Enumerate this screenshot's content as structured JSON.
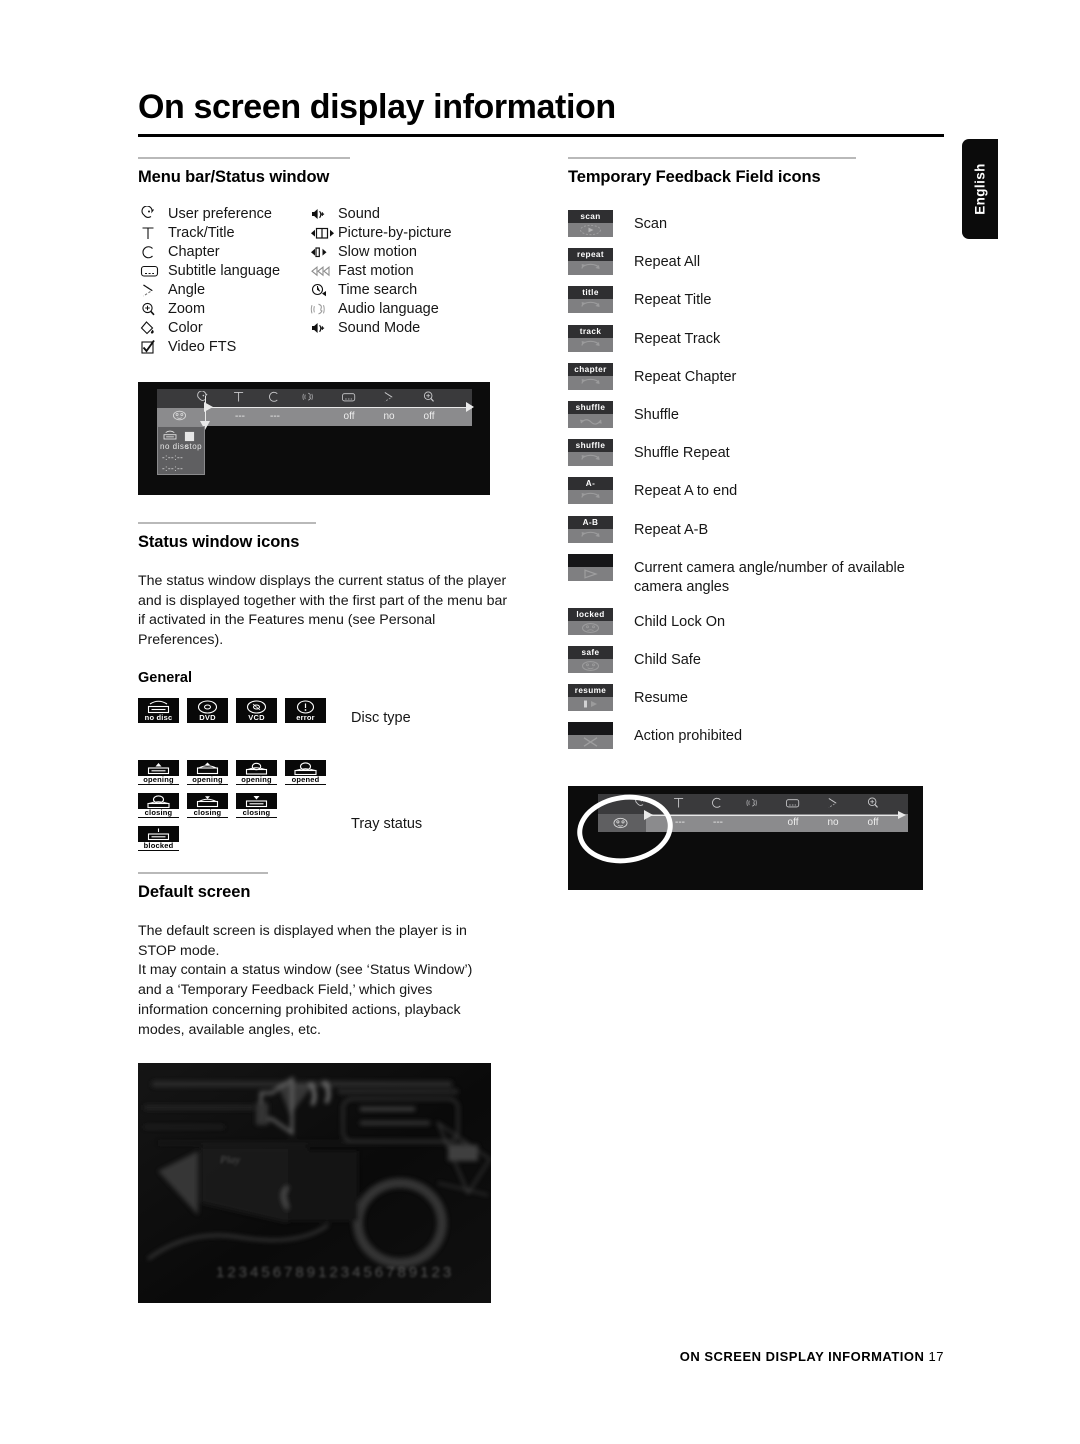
{
  "page": {
    "title": "On screen display information",
    "language_tab": "English",
    "footer_text": "ON SCREEN DISPLAY INFORMATION",
    "footer_page": "17"
  },
  "menu_bar_section": {
    "heading": "Menu bar/Status window",
    "column_a": [
      {
        "icon": "user-preference-icon",
        "label": "User preference"
      },
      {
        "icon": "track-title-icon",
        "label": "Track/Title"
      },
      {
        "icon": "chapter-icon",
        "label": "Chapter"
      },
      {
        "icon": "subtitle-language-icon",
        "label": "Subtitle language"
      },
      {
        "icon": "angle-icon",
        "label": "Angle"
      },
      {
        "icon": "zoom-icon",
        "label": "Zoom"
      },
      {
        "icon": "color-icon",
        "label": "Color"
      },
      {
        "icon": "video-fts-icon",
        "label": "Video FTS"
      }
    ],
    "column_b": [
      {
        "icon": "sound-icon",
        "label": "Sound"
      },
      {
        "icon": "picture-by-picture-icon",
        "label": "Picture-by-picture"
      },
      {
        "icon": "slow-motion-icon",
        "label": "Slow motion"
      },
      {
        "icon": "fast-motion-icon",
        "label": "Fast motion"
      },
      {
        "icon": "time-search-icon",
        "label": "Time search"
      },
      {
        "icon": "audio-language-icon",
        "label": "Audio language"
      },
      {
        "icon": "sound-mode-icon",
        "label": "Sound Mode"
      }
    ]
  },
  "menu_bar_screenshot": {
    "bar_values": [
      "---",
      "---",
      "",
      "off",
      "no",
      "off"
    ],
    "status_disc": "no disc",
    "status_mode": "stop",
    "status_time_1": "-:--:--",
    "status_time_2": "-:--:--"
  },
  "status_window_section": {
    "heading": "Status window icons",
    "body": "The status window displays the current status of the player and is displayed together with the first part of the menu bar if activated in the Features menu (see Personal Preferences).",
    "subheading": "General",
    "disc_type_caption": "Disc type",
    "disc_type_tiles": [
      "no disc",
      "DVD",
      "VCD",
      "error"
    ],
    "tray_status_caption": "Tray status",
    "tray_status_rows": [
      [
        "opening",
        "opening",
        "opening",
        "opened"
      ],
      [
        "closing",
        "closing",
        "closing"
      ],
      [
        "blocked"
      ]
    ]
  },
  "default_screen_section": {
    "heading": "Default screen",
    "body_1": "The default screen is displayed when the player is in STOP mode.",
    "body_2": "It may contain a status window (see ‘Status Window’) and a ‘Temporary Feedback Field,’ which gives information concerning prohibited actions, playback modes, available angles, etc."
  },
  "tff_section": {
    "heading": "Temporary Feedback Field icons",
    "items": [
      {
        "cap": "scan",
        "art": "play-dots",
        "label": "Scan"
      },
      {
        "cap": "repeat",
        "art": "repeat-loop",
        "label": "Repeat All"
      },
      {
        "cap": "title",
        "art": "repeat-loop",
        "label": "Repeat Title"
      },
      {
        "cap": "track",
        "art": "repeat-loop",
        "label": "Repeat Track"
      },
      {
        "cap": "chapter",
        "art": "repeat-loop",
        "label": "Repeat Chapter"
      },
      {
        "cap": "shuffle",
        "art": "shuffle-arrows",
        "label": "Shuffle"
      },
      {
        "cap": "shuffle",
        "art": "repeat-loop",
        "label": "Shuffle Repeat"
      },
      {
        "cap": "A-",
        "art": "repeat-loop",
        "label": "Repeat A to end"
      },
      {
        "cap": "A-B",
        "art": "repeat-loop",
        "label": "Repeat A-B"
      },
      {
        "cap": "",
        "art": "angle-arrow",
        "label": "Current camera angle/number of available camera angles"
      },
      {
        "cap": "locked",
        "art": "face-icon",
        "label": "Child Lock On"
      },
      {
        "cap": "safe",
        "art": "face-icon",
        "label": "Child Safe"
      },
      {
        "cap": "resume",
        "art": "pause-play",
        "label": "Resume"
      },
      {
        "cap": "",
        "art": "cross-mark",
        "label": "Action prohibited"
      }
    ]
  },
  "tff_screenshot": {
    "bar_values": [
      "---",
      "---",
      "",
      "off",
      "no",
      "off"
    ]
  },
  "colors": {
    "page_background": "#ffffff",
    "text": "#161616",
    "rule": "#b9b9b9",
    "title_rule": "#000000",
    "tab_background": "#0b0b0b",
    "tff_cap_background": "#2f2f31",
    "tff_pane_background": "#7f7f81",
    "screenshot_background": "#0c0c0c",
    "menubar_top": "#3a3a3c",
    "menubar_bottom": "#8b8b8d"
  }
}
